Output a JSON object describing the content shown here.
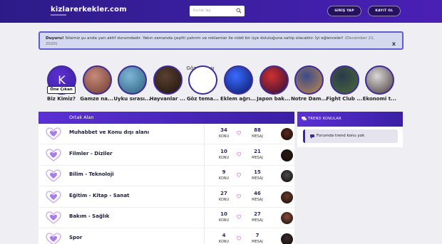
{
  "header": {
    "logo": "kizlarerkekler.com",
    "search_placeholder": "Ara hikr Yazj",
    "login_label": "GİRİŞ YAP",
    "register_label": "KAYIT OL"
  },
  "notice": {
    "title": "Duyuru!",
    "text": "Sitemiz şu anda yarı aktif durumdadır. Yakın zamanda çeşitli yatırım ve reklamlar ile ciddi bir üye doluluğuna sahip olacaktır. İyi eğlenceler!",
    "date": "(December 21, 2020)",
    "close": "x"
  },
  "circles": [
    {
      "label": "Biz Kimiz?",
      "letter": "K",
      "tag": "Öne Çıkan",
      "colors": [
        "#5d2fd0",
        "#3b1fa0"
      ]
    },
    {
      "label": "Gamze na...",
      "colors": [
        "#c98a7a",
        "#6a3b30"
      ]
    },
    {
      "label": "Uyku sırası...",
      "colors": [
        "#7fb6d6",
        "#2b5e7e"
      ]
    },
    {
      "label": "Hayvanlar ...",
      "colors": [
        "#5a4030",
        "#1e140e"
      ]
    },
    {
      "label": "Göz tema...",
      "alt": "Göz teması"
    },
    {
      "label": "Eklem ağrı...",
      "colors": [
        "#3a6bff",
        "#0b1a66"
      ]
    },
    {
      "label": "Japon bak...",
      "colors": [
        "#d03030",
        "#2a0f3a"
      ]
    },
    {
      "label": "Notre Dam...",
      "colors": [
        "#3a4a8a",
        "#c08a4a"
      ]
    },
    {
      "label": "Fight Club ...",
      "colors": [
        "#2a3a4a",
        "#4a6a3a"
      ]
    },
    {
      "label": "Ekonomi t...",
      "colors": [
        "#d8d8d8",
        "#4a3a3a"
      ]
    }
  ],
  "forum": {
    "title": "Ortak Alan",
    "konu_label": "KONU",
    "mesaj_label": "MESAJ",
    "rows": [
      {
        "name": "Muhabbet ve Konu dışı alanı",
        "konu": "34",
        "mesaj": "88"
      },
      {
        "name": "Filmler - Diziler",
        "konu": "10",
        "mesaj": "21"
      },
      {
        "name": "Bilim - Teknoloji",
        "konu": "9",
        "mesaj": "15"
      },
      {
        "name": "Eğitim - Kitap - Sanat",
        "konu": "27",
        "mesaj": "46"
      },
      {
        "name": "Bakım - Sağlık",
        "konu": "10",
        "mesaj": "27"
      },
      {
        "name": "Spor",
        "konu": "4",
        "mesaj": "7"
      }
    ]
  },
  "trend": {
    "title": "TREND KONULAR",
    "empty_text": "Forumda trend konu yok"
  },
  "colors": {
    "brand": "#3d1fa3",
    "accent": "#5b2fd4"
  }
}
